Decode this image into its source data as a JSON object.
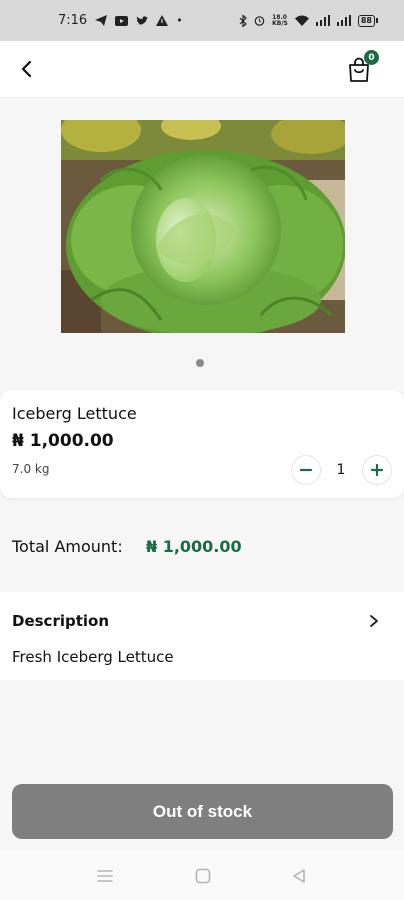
{
  "status_bar": {
    "time": "7:16",
    "data_speed_top": "18.0",
    "data_speed_bottom": "KB/S",
    "battery": "88"
  },
  "header": {
    "cart_count": "0"
  },
  "product": {
    "name": "Iceberg Lettuce",
    "price": "₦ 1,000.00",
    "weight": "7.0 kg",
    "quantity": "1"
  },
  "total": {
    "label": "Total Amount:",
    "value": "₦ 1,000.00"
  },
  "description": {
    "title": "Description",
    "text": "Fresh Iceberg Lettuce"
  },
  "cta": {
    "label": "Out of stock"
  },
  "colors": {
    "brand_green": "#1b6b45",
    "disabled_button": "#7f7f7f"
  },
  "icons": [
    "back-arrow-icon",
    "shopping-bag-icon",
    "minus-icon",
    "plus-icon",
    "chevron-right-icon",
    "nav-menu-icon",
    "nav-home-icon",
    "nav-back-icon"
  ]
}
